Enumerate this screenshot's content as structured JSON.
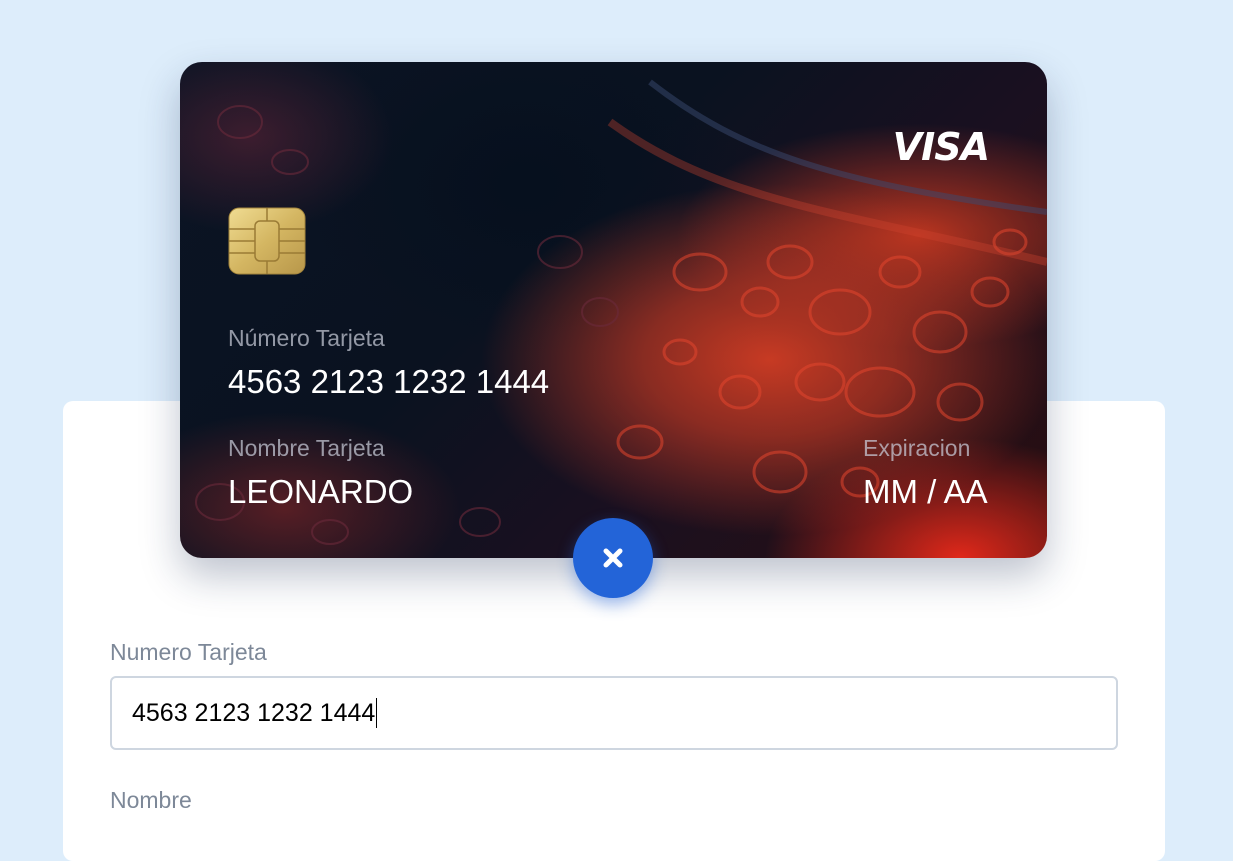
{
  "card": {
    "brand": "VISA",
    "number_label": "Número Tarjeta",
    "number_value": "4563 2123 1232 1444",
    "name_label": "Nombre Tarjeta",
    "name_value": "LEONARDO",
    "expiry_label": "Expiracion",
    "expiry_value": "MM / AA",
    "chip_icon": "chip-icon"
  },
  "close_button": {
    "icon": "close-icon",
    "color": "#2364d8"
  },
  "form": {
    "card_number_label": "Numero Tarjeta",
    "card_number_value": "4563 2123 1232 1444",
    "name_label": "Nombre"
  },
  "colors": {
    "background": "#ddedfb",
    "panel": "#ffffff",
    "label": "#7d8898",
    "accent": "#2364d8"
  }
}
